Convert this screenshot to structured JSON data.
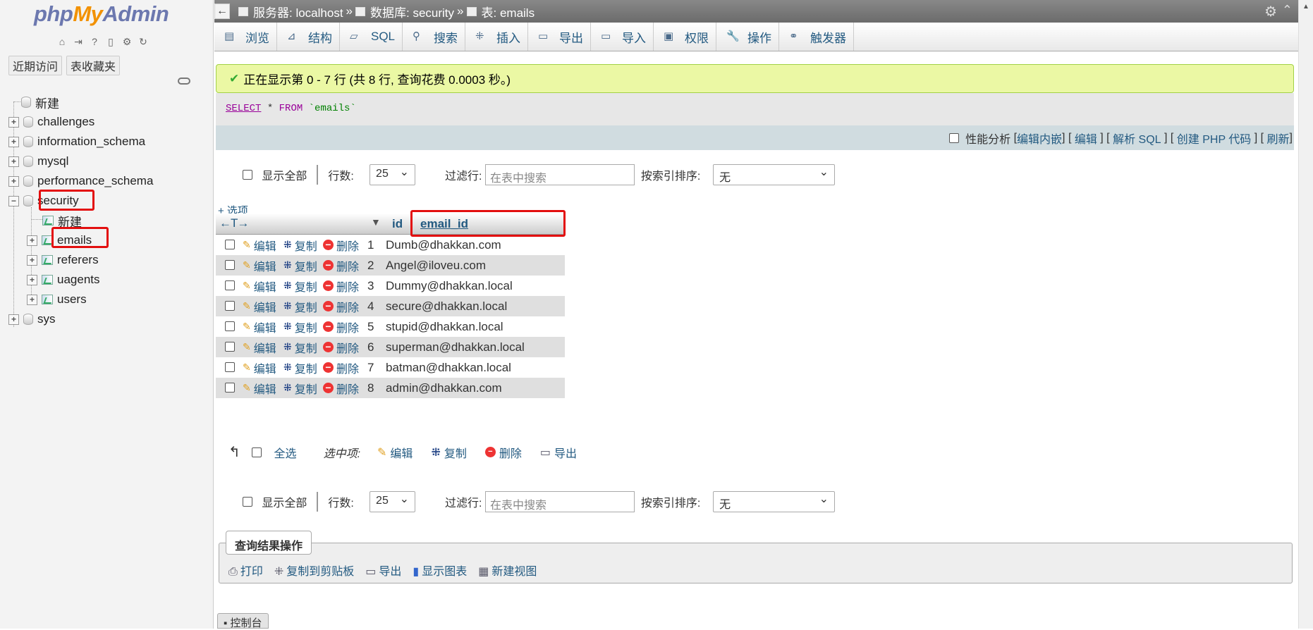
{
  "logo": {
    "pre": "php",
    "mid": "My",
    "post": "Admin"
  },
  "nav_tabs": [
    "近期访问",
    "表收藏夹"
  ],
  "tree": {
    "new_label": "新建",
    "databases": [
      "challenges",
      "information_schema",
      "mysql",
      "performance_schema",
      "security",
      "sys"
    ],
    "security_children": {
      "new_label": "新建",
      "tables": [
        "emails",
        "referers",
        "uagents",
        "users"
      ]
    }
  },
  "topbar": {
    "back": "←",
    "server": "服务器: localhost",
    "sep": "»",
    "database": "数据库: security",
    "table": "表: emails"
  },
  "menu": [
    "浏览",
    "结构",
    "SQL",
    "搜索",
    "插入",
    "导出",
    "导入",
    "权限",
    "操作",
    "触发器"
  ],
  "success_msg": "正在显示第 0 - 7 行 (共 8 行, 查询花费 0.0003 秒。)",
  "sql": {
    "select": "SELECT",
    "star": " * ",
    "from": "FROM",
    "table": " `emails`"
  },
  "sql_tools": {
    "profiling": "性能分析",
    "links": [
      "编辑内嵌",
      "编辑",
      "解析 SQL",
      "创建 PHP 代码",
      "刷新"
    ]
  },
  "controls": {
    "show_all": "显示全部",
    "rows_label": "行数:",
    "rows_value": "25",
    "filter_label": "过滤行:",
    "filter_placeholder": "在表中搜索",
    "sort_label": "按索引排序:",
    "sort_value": "无"
  },
  "options_link": "+ 选项",
  "table": {
    "arrows": "←T→",
    "columns": [
      "id",
      "email_id"
    ],
    "actions": [
      "编辑",
      "复制",
      "删除"
    ],
    "rows": [
      {
        "id": "1",
        "email": "Dumb@dhakkan.com"
      },
      {
        "id": "2",
        "email": "Angel@iloveu.com"
      },
      {
        "id": "3",
        "email": "Dummy@dhakkan.local"
      },
      {
        "id": "4",
        "email": "secure@dhakkan.local"
      },
      {
        "id": "5",
        "email": "stupid@dhakkan.local"
      },
      {
        "id": "6",
        "email": "superman@dhakkan.local"
      },
      {
        "id": "7",
        "email": "batman@dhakkan.local"
      },
      {
        "id": "8",
        "email": "admin@dhakkan.com"
      }
    ]
  },
  "bulk": {
    "select_all": "全选",
    "with_selected": "选中项:",
    "actions": [
      "编辑",
      "复制",
      "删除",
      "导出"
    ]
  },
  "query_ops": {
    "title": "查询结果操作",
    "links": [
      "打印",
      "复制到剪贴板",
      "导出",
      "显示图表",
      "新建视图"
    ]
  },
  "console": "控制台",
  "colors": {
    "link": "#235a81",
    "success_bg": "#ebf8a4",
    "highlight": "#e30f0f"
  }
}
